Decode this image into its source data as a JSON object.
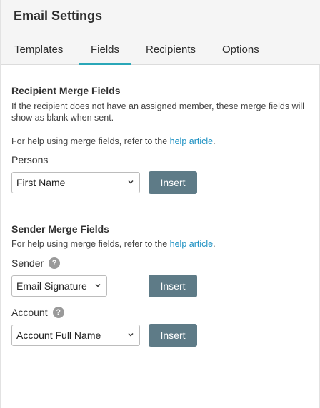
{
  "header": {
    "title": "Email Settings"
  },
  "tabs": [
    {
      "label": "Templates"
    },
    {
      "label": "Fields"
    },
    {
      "label": "Recipients"
    },
    {
      "label": "Options"
    }
  ],
  "active_tab": "Fields",
  "recipient_section": {
    "title": "Recipient Merge Fields",
    "description": "If the recipient does not have an assigned member, these merge fields will show as blank when sent.",
    "help_prefix": "For help using merge fields, refer to the ",
    "help_link": "help article",
    "help_suffix": ".",
    "persons_label": "Persons",
    "persons_select": "First Name",
    "insert_label": "Insert"
  },
  "sender_section": {
    "title": "Sender Merge Fields",
    "help_prefix": "For help using merge fields, refer to the ",
    "help_link": "help article",
    "help_suffix": ".",
    "sender_label": "Sender",
    "sender_select": "Email Signature",
    "account_label": "Account",
    "account_select": "Account Full Name",
    "insert_label": "Insert"
  },
  "colors": {
    "accent": "#2aa7b8",
    "button": "#5e7b87",
    "link": "#1a8fc1"
  }
}
